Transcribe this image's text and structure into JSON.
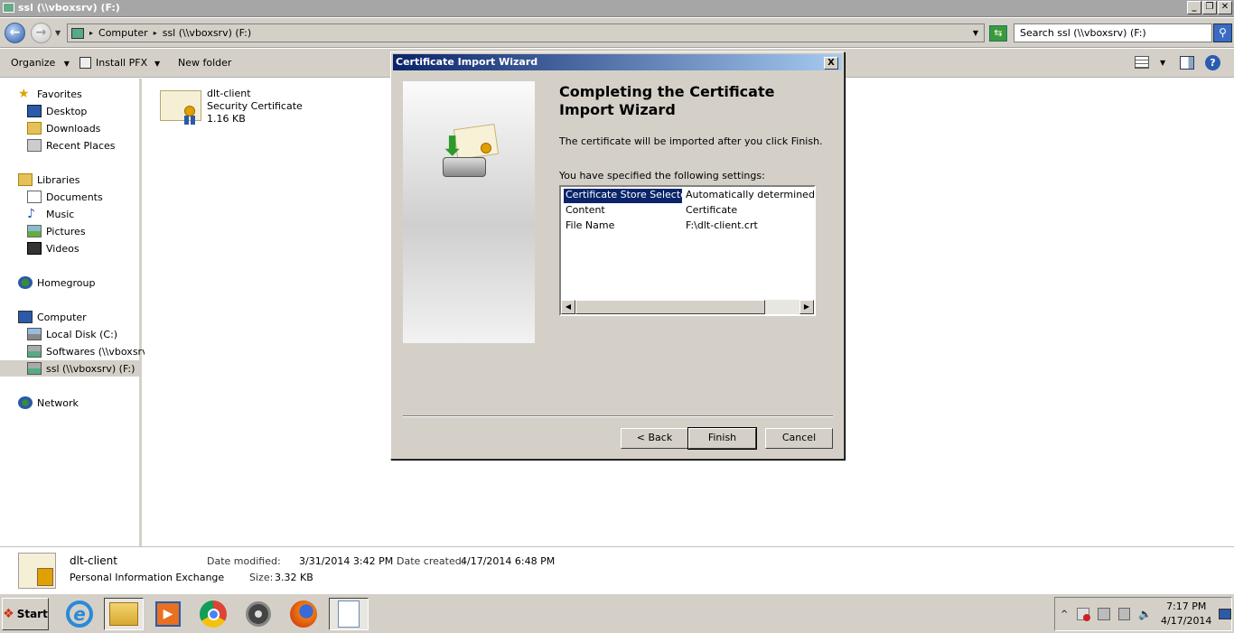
{
  "window": {
    "title": "ssl (\\\\vboxsrv) (F:)"
  },
  "address": {
    "parts": [
      "Computer",
      "ssl (\\\\vboxsrv) (F:)"
    ],
    "search_placeholder": "Search ssl (\\\\vboxsrv) (F:)"
  },
  "toolbar": {
    "organize": "Organize",
    "install_pfx": "Install PFX",
    "new_folder": "New folder"
  },
  "sidebar": {
    "favorites": "Favorites",
    "desktop": "Desktop",
    "downloads": "Downloads",
    "recent": "Recent Places",
    "libraries": "Libraries",
    "documents": "Documents",
    "music": "Music",
    "pictures": "Pictures",
    "videos": "Videos",
    "homegroup": "Homegroup",
    "computer": "Computer",
    "local_disk": "Local Disk (C:)",
    "softwares": "Softwares (\\\\vboxsrv)",
    "ssl": "ssl (\\\\vboxsrv) (F:)",
    "network": "Network"
  },
  "file": {
    "name": "dlt-client",
    "type": "Security Certificate",
    "size": "1.16 KB"
  },
  "details": {
    "name": "dlt-client",
    "type": "Personal Information Exchange",
    "modified_label": "Date modified:",
    "modified": "3/31/2014 3:42 PM",
    "size_label": "Size:",
    "size": "3.32 KB",
    "created_label": "Date created:",
    "created": "4/17/2014 6:48 PM"
  },
  "dialog": {
    "title": "Certificate Import Wizard",
    "heading": "Completing the Certificate Import Wizard",
    "info": "The certificate will be imported after you click Finish.",
    "settings_label": "You have specified the following settings:",
    "settings": [
      {
        "name": "Certificate Store Selected",
        "value": "Automatically determined by t"
      },
      {
        "name": "Content",
        "value": "Certificate"
      },
      {
        "name": "File Name",
        "value": "F:\\dlt-client.crt"
      }
    ],
    "back": "< Back",
    "finish": "Finish",
    "cancel": "Cancel",
    "close": "X"
  },
  "taskbar": {
    "start": "Start",
    "time": "7:17 PM",
    "date": "4/17/2014"
  }
}
